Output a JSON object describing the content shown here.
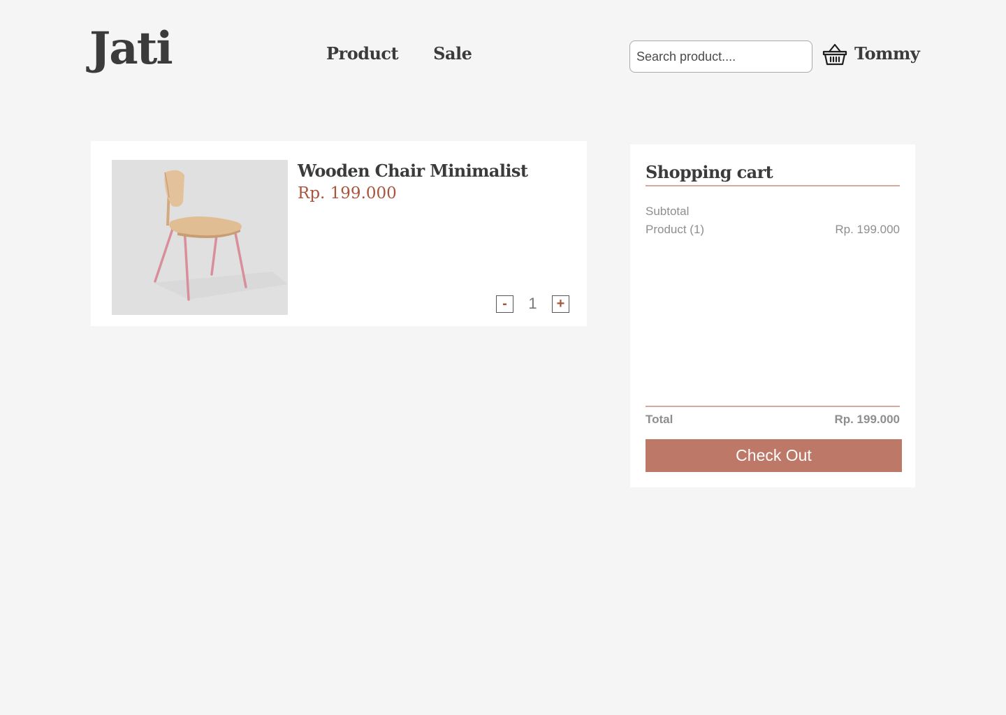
{
  "brand": {
    "logo": "Jati"
  },
  "nav": {
    "items": [
      "Product",
      "Sale"
    ]
  },
  "search": {
    "placeholder": "Search product...."
  },
  "user": {
    "name": "Tommy"
  },
  "product": {
    "name": "Wooden Chair Minimalist",
    "price": "Rp. 199.000",
    "quantity": "1",
    "decrement_label": "-",
    "increment_label": "+"
  },
  "cart": {
    "title": "Shopping cart",
    "subtotal_label": "Subtotal",
    "line_label": "Product (1)",
    "line_value": "Rp. 199.000",
    "total_label": "Total",
    "total_value": "Rp. 199.000",
    "checkout_label": "Check Out"
  },
  "colors": {
    "accent": "#bd7867",
    "price": "#a8553b",
    "background": "#f5f5f5",
    "divider": "#d9a79c"
  },
  "icons": {
    "basket": "basket-icon"
  }
}
